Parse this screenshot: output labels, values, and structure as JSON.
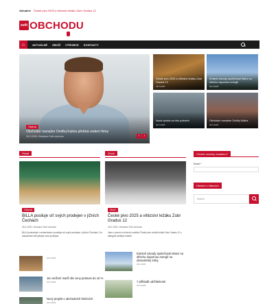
{
  "ticker": {
    "label": "Aktuálně",
    "text": "České pivo 2025 a vítězství ležáku Zubr Gradus 12"
  },
  "logo": {
    "badge": "svět",
    "word": "OBCHODU"
  },
  "nav": {
    "home_icon": "home-icon",
    "items": [
      "Aktuálně",
      "Zboží",
      "Výrobce",
      "Kontakty"
    ],
    "search_icon": "search-icon"
  },
  "hero": {
    "category": "Obchod",
    "title": "Obchodní manažer Ondřej Kalina přebírá vedení firmy",
    "meta": "28.3.2025 • Redakce Svět obchodu",
    "prev": "‹",
    "next": "›"
  },
  "tiles": [
    {
      "title": "České pivo 2025 a vítězství ležáku Zubr Gradus 12",
      "meta": "28.3.2025"
    },
    {
      "title": "Emisně závody společnosti Wanz na střechu úspornou energií",
      "meta": "28.3.2025"
    },
    {
      "title": "Nová výroba na trhu potravin",
      "meta": "28.3.2025"
    },
    {
      "title": "Obchodní manažer Ondřej Kalina",
      "meta": "28.3.2025"
    }
  ],
  "sections": {
    "left": {
      "label": "Retail"
    },
    "middle": {
      "label": "Zboží"
    }
  },
  "left_article": {
    "tag": "Obchod",
    "title": "BILLA posiluje síť svých prodejen v jižních Čechách",
    "meta": "28.3.2025 • Redakce Svět obchodu",
    "excerpt": "BILLA pokračuje v modernizaci a posiluje síť svých prodejen v jižních Čechách. Do zákaznické sítě přibyla nová prodejna."
  },
  "middle_article": {
    "tag": "Zboží",
    "title": "České pivo 2025 a vítězství ležáku Zubr Gradus 12",
    "meta": "28.3.2025 • Redakce Svět obchodu",
    "excerpt": "Jako v prvních ročnících soutěže České pivo zvítězil ležák Zubr Gradus 12 v kategorii světlých ležáků."
  },
  "left_list": [
    {
      "title": "",
      "meta": "28.3.2025"
    },
    {
      "title": "Jen snížení marží dle ceny potravin do 10 %",
      "meta": "28.3.2025"
    },
    {
      "title": "Nový projekt v obchodních řetězcích",
      "meta": "28.3.2025"
    }
  ],
  "middle_list": [
    {
      "title": "Emisně závody společnosti Wanz na střechu úspornou energií na obnovitelný zdroj",
      "meta": "28.3.2025"
    },
    {
      "title": "7 příkladů udržitelnosti",
      "meta": "28.3.2025"
    }
  ],
  "sidebar": {
    "newsletter_title": "Chcete novinky emailem?",
    "email_label": "Email *",
    "search_title": "Hledání v článcích",
    "search_placeholder": "Search"
  },
  "colors": {
    "accent": "#c8102e",
    "nav_bg": "#1b1b1b"
  }
}
